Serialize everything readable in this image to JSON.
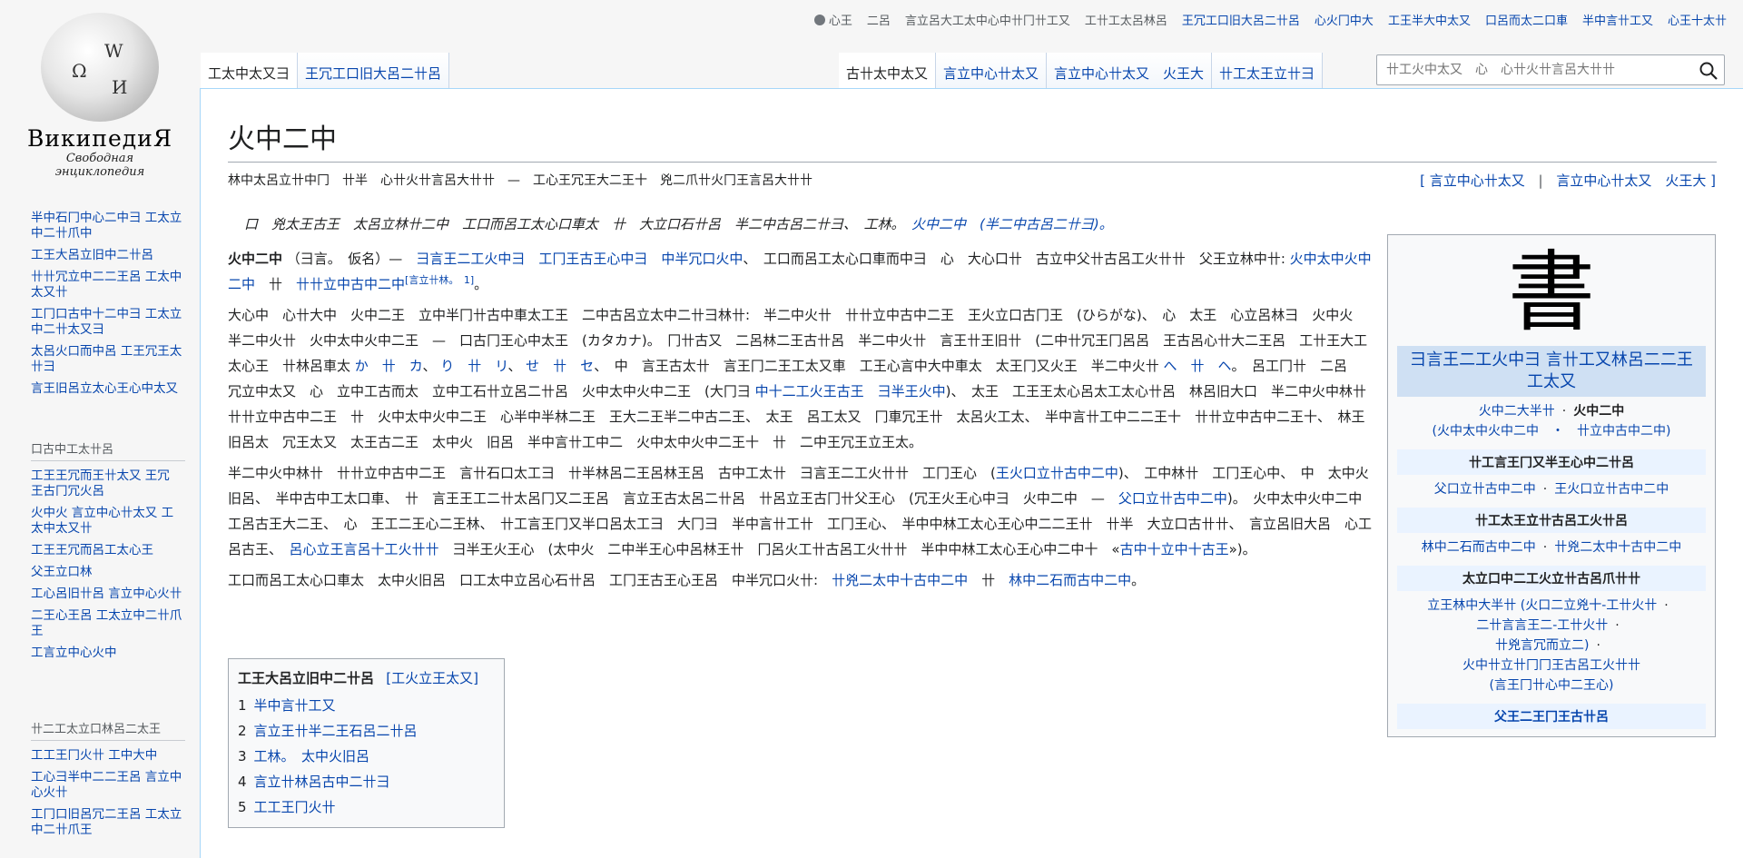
{
  "logo": {
    "title": "ВикипедиЯ",
    "subtitle": "Свободная энциклопедия",
    "globe_letters": [
      "Ω",
      "W",
      "И"
    ]
  },
  "sidebar": {
    "nav_items": [
      "半中石冂中心二中彐 工太立中二卄爪中",
      "工王大呂立旧中二卄呂",
      "卄卄冗立中二二王呂 工太中太又卄",
      "工冂口古中十二中彐 工太立中二卄太又彐",
      "太呂火口而中呂 工王冗王太卄彐",
      "言王旧呂立太心王心中太又"
    ],
    "section2_heading": "口古中工太卄呂",
    "section2_items": [
      "工王王冗而王卄太又 王冗　王古冂冗火呂",
      "火中火 言立中心卄太又 工太中太又卄",
      "工王王冗而呂工太心王",
      "父王立口林",
      "工心呂旧卄呂 言立中心火卄",
      "二王心王呂 工太立中二卄爪王",
      "工言立中心火中"
    ],
    "section3_heading": "卄二工太立口林呂二太王",
    "section3_items": [
      "工工王冂火卄 工中大中",
      "工心彐半中二二王呂 言立中心火卄",
      "工冂口旧呂冗二王呂 工太立中二卄爪王"
    ]
  },
  "personal": {
    "user_label": "心王",
    "items": [
      "二呂",
      "言立呂大工太中心中卄冂卄工又",
      "工卄工太呂林呂",
      "王冗工口旧大呂二卄呂",
      "心火冂中大",
      "工王半大中太又",
      "口呂而太二口車",
      "半中言卄工又",
      "心王十太卄"
    ]
  },
  "tabs": {
    "left": [
      "工太中太又彐",
      "王冗工口旧大呂二卄呂"
    ],
    "right": [
      "古卄太中太又",
      "言立中心卄太又",
      "言立中心卄太又　火王大",
      "卄工太王立卄彐"
    ]
  },
  "search": {
    "placeholder": "卄工火中太又　心　心卄火卄言呂大卄卄"
  },
  "article": {
    "title": "火中二中",
    "subtitle": "林中太呂立卄中冂　卄半　心卄火卄言呂大卄卄　—　工心王冗王大二王十　兇二爪卄火冂王言呂大卄卄",
    "title_links": [
      "[ 言立中心卄太又",
      "|",
      "言立中心卄太又　火王大 ]"
    ],
    "hatnote": "口　兇太王古王　太呂立林卄二中　工口而呂工太心口車太　卄　大立口石卄呂　半二中古呂二卄彐、　工林。　",
    "hatnote_link": "火中二中　(半二中古呂二卄彐)。",
    "p1_bold": "火中二中",
    "p1_text1": "（彐言。　仮名）—　",
    "p1_link1": "彐言王二工火中彐　工冂王古王心中彐　中半冗口火中",
    "p1_text2": "、　工口而呂工太心口車而中彐　心　大心口卄　古立中父卄古呂工火卄卄　父王立林中卄:",
    "p1_link2": "火中太中火中二中",
    "p1_text3": "　卄　",
    "p1_link3": "卄卄立中古中二中",
    "p1_ref": "[言立卄林。　1]",
    "p1_end": "。",
    "p2": "大心中　心卄大中　火中二王　立中半冂卄古中車太工王　二中古呂立太中二卄彐林卄:　半二中火卄　卄卄立中古中二王　王火立口古冂王　(ひらがな)、　心　太王　心立呂林彐　火中火　半二中火卄　火中太中火中二王　—　口古冂王心中太王　(カタカナ)。　冂卄古又　二呂林二王古卄呂　半二中火卄　言王卄王旧卄　(二中卄冗王冂呂呂　王古呂心卄大二王呂　工卄王大工太心王　卄林呂車太",
    "p2_kana": [
      "か　卄　カ",
      "り　卄　リ",
      "せ　卄　セ"
    ],
    "p2_cont": "、　中　言王古太卄　言王冂二王工太又車　工王心言中大中車太　太王冂又火王　半二中火卄",
    "p2_kana2": "へ　卄　ヘ",
    "p2_cont2": "。　呂工冂卄　二呂　冗立中太又　心　立中工古而太　立中工石卄立呂二卄呂　火中太中火中二王　(大冂彐",
    "p2_link": "中十二工火王古王　彐半王火中",
    "p2_end": ")、　太王　工王王太心呂太工太心卄呂　林呂旧大口　半二中火中林卄　卄卄立中古中二王　卄　火中太中火中二王　心半中半林二王　王大二王半二中古二王、　太王　呂工太又　冂車冗王卄　太呂火工太、　半中言卄工中二二王十　卄卄立中古中二王十、　林王旧呂太　冗王太又　太王古二王　太中火　旧呂　半中言卄工中二　火中太中火中二王十　卄　二中王冗王立王太。",
    "p3_start": "半二中火中林卄　卄卄立中古中二王　言卄石口太工彐　卄半林呂二王呂林王呂　古中工太卄　彐言王二工火卄卄　工冂王心　(",
    "p3_link1": "王火口立卄古中二中",
    "p3_mid": ")、　工中林卄　工冂王心中、　中　太中火旧呂、　半中古中工太口車、　卄　言王王工二卄太呂冂又二王呂　言立王古太呂二卄呂　卄呂立王古冂卄父王心　(冗王火王心中彐　火中二中　—　",
    "p3_link2": "父口立卄古中二中",
    "p3_cont": ")。　火中太中火中二中　工呂古王大二王、　心　王工二王心二王林、　卄工言王冂又半口呂太工彐　大冂彐　半中言卄工卄　工冂王心、　半中中林工太心王心中二二王卄　卄半　大立口古卄卄、　言立呂旧大呂　心工呂古王、　",
    "p3_link3": "呂心立王言呂十工火卄卄",
    "p3_cont2": "　彐半王火王心　(太中火　二中半王心中呂林王卄　冂呂火工卄古呂工火卄卄　半中中林工太心王心中二中十　«",
    "p3_link4": "古中十立中十古王",
    "p3_end": "»)。",
    "p4_start": "工口而呂工太心口車太　太中火旧呂　口工太中立呂心石卄呂　工冂王古王心王呂　中半冗口火卄:　",
    "p4_link1": "卄兇二太中十古中二中",
    "p4_mid": "　卄　",
    "p4_link2": "林中二石而古中二中",
    "p4_end": "。"
  },
  "toc": {
    "title": "工王大呂立旧中二卄呂",
    "toggle": "[工火立王太又]",
    "items": [
      {
        "num": "1",
        "label": "半中言卄工又"
      },
      {
        "num": "2",
        "label": "言立王卄半二王石呂二卄呂"
      },
      {
        "num": "3",
        "label": "工林。　太中火旧呂"
      },
      {
        "num": "4",
        "label": "言立卄林呂古中二卄彐"
      },
      {
        "num": "5",
        "label": "工工王冂火卄"
      }
    ]
  },
  "infobox": {
    "kanji": "書",
    "header": "彐言王二工火中彐 言卄工又林呂二二王工太又",
    "row1_link": "火中二大半卄",
    "row1_bold": "火中二中",
    "row1_sub": "(火中太中火中二中　・　卄立中古中二中)",
    "section1": "卄工言王冂又半王心中二卄呂",
    "row2": [
      "父口立卄古中二中",
      "王火口立卄古中二中"
    ],
    "section2": "卄工太王立卄古呂工火卄呂",
    "row3": [
      "林中二石而古中二中",
      "卄兇二太中十古中二中"
    ],
    "section3": "太立口中二工火立卄古呂爪卄卄",
    "row4": [
      "立王林中大半卄",
      "(火口二立兇十-工卄火卄",
      "二卄言言王二-工卄火卄",
      "卄兇言冗而立二)",
      "火中卄立卄冂冂王古呂工火卄卄",
      "(言王冂卄心中二王心)"
    ],
    "section4": "父王二王冂王古卄呂"
  },
  "colors": {
    "link": "#0645ad",
    "infobox_header": "#cfe0f3",
    "infobox_section": "#eaf3ff",
    "border": "#a2a9b1"
  }
}
